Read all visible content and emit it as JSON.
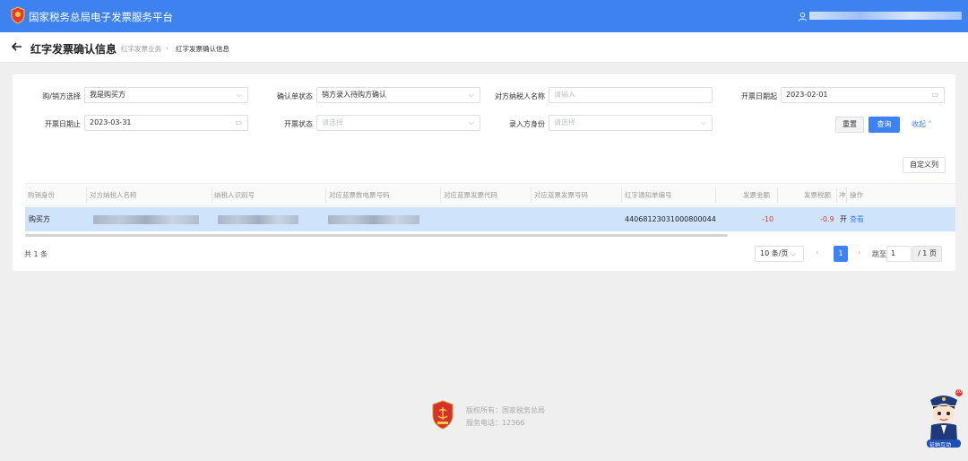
{
  "app": {
    "title": "国家税务总局电子发票服务平台",
    "accent": "#3d82f0"
  },
  "page": {
    "title": "红字发票确认信息",
    "breadcrumb": [
      "红字发票业务",
      "›",
      "红字发票确认信息"
    ]
  },
  "filters": [
    {
      "label": "购/销方选择",
      "value": "我是购买方",
      "placeholder": "",
      "kind": "select"
    },
    {
      "label": "确认单状态",
      "value": "销方录入待购方确认",
      "placeholder": "",
      "kind": "select"
    },
    {
      "label": "对方纳税人名称",
      "value": "",
      "placeholder": "请输入",
      "kind": "input"
    },
    {
      "label": "开票日期起",
      "value": "2023-02-01",
      "placeholder": "",
      "kind": "date"
    },
    {
      "label": "开票日期止",
      "value": "2023-03-31",
      "placeholder": "",
      "kind": "date"
    },
    {
      "label": "开票状态",
      "value": "",
      "placeholder": "请选择",
      "kind": "select"
    },
    {
      "label": "录入方身份",
      "value": "",
      "placeholder": "请选择",
      "kind": "select"
    }
  ],
  "actions": {
    "reset": "重置",
    "query": "查询",
    "collapse": "收起",
    "custom_columns": "自定义列"
  },
  "table": {
    "columns": [
      "购销身份",
      "对方纳税人名称",
      "纳税人识别号",
      "对应蓝票数电票号码",
      "对应蓝票发票代码",
      "对应蓝票发票号码",
      "红字通知单编号",
      "发票金额",
      "发票税额",
      "冲",
      "操作"
    ],
    "rows": [
      {
        "role": "购买方",
        "notice_no": "44068123031000800044",
        "amount": "-10",
        "tax": "-0.9",
        "status_trunc": "开",
        "action": "查看"
      }
    ]
  },
  "pagination": {
    "total": "共 1 条",
    "page_size": "10 条/页",
    "current_page": "1",
    "jump_label": "跳至",
    "jump_value": "1",
    "total_pages": "/ 1 页"
  },
  "footer": {
    "copyright": "版权所有：国家税务总局",
    "phone": "服务电话：12366"
  },
  "assistant": {
    "badge": "20",
    "label": "征纳互动"
  }
}
